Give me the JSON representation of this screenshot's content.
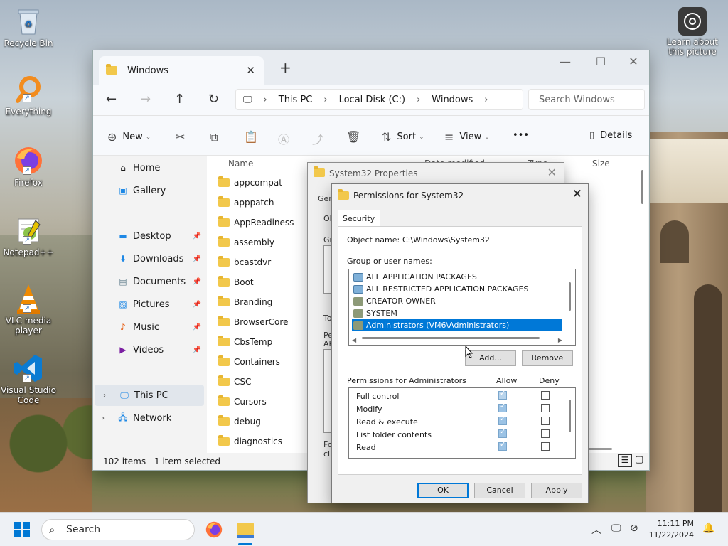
{
  "desktop": {
    "icons": [
      {
        "label": "Recycle Bin",
        "icon": "recycle-bin-icon"
      },
      {
        "label": "Everything",
        "icon": "everything-search-icon"
      },
      {
        "label": "Firefox",
        "icon": "firefox-icon"
      },
      {
        "label": "Notepad++",
        "icon": "notepad-plus-plus-icon"
      },
      {
        "label": "VLC media player",
        "icon": "vlc-icon"
      },
      {
        "label": "Visual Studio Code",
        "icon": "vscode-icon"
      }
    ],
    "learn": {
      "label": "Learn about this picture",
      "icon": "camera-icon"
    }
  },
  "explorer": {
    "tab_title": "Windows",
    "breadcrumbs": [
      "This PC",
      "Local Disk (C:)",
      "Windows"
    ],
    "search_placeholder": "Search Windows",
    "commands": {
      "new": "New",
      "sort": "Sort",
      "view": "View",
      "more": "•••",
      "details": "Details"
    },
    "sidebar": {
      "home": "Home",
      "gallery": "Gallery",
      "desktop": "Desktop",
      "downloads": "Downloads",
      "documents": "Documents",
      "pictures": "Pictures",
      "music": "Music",
      "videos": "Videos",
      "this_pc": "This PC",
      "network": "Network"
    },
    "columns": {
      "name": "Name",
      "date": "Date modified",
      "type": "Type",
      "size": "Size"
    },
    "files": [
      "appcompat",
      "apppatch",
      "AppReadiness",
      "assembly",
      "bcastdvr",
      "Boot",
      "Branding",
      "BrowserCore",
      "CbsTemp",
      "Containers",
      "CSC",
      "Cursors",
      "debug",
      "diagnostics"
    ],
    "status": {
      "items": "102 items",
      "selected": "1 item selected"
    }
  },
  "properties_dialog": {
    "title": "System32 Properties",
    "fragments": {
      "gen": "Gen",
      "obj": "Ob",
      "grp": "Gro",
      "to": "To",
      "per": "Per",
      "ap": "AP",
      "for": "For",
      "cli": "clic"
    }
  },
  "permissions_dialog": {
    "title": "Permissions for System32",
    "tab": "Security",
    "object_name_label": "Object name:",
    "object_name_value": "C:\\Windows\\System32",
    "group_label": "Group or user names:",
    "groups": [
      "ALL APPLICATION PACKAGES",
      "ALL RESTRICTED APPLICATION PACKAGES",
      "CREATOR OWNER",
      "SYSTEM",
      "Administrators (VM6\\Administrators)"
    ],
    "add_button": "Add...",
    "remove_button": "Remove",
    "permissions_label": "Permissions for Administrators",
    "allow_label": "Allow",
    "deny_label": "Deny",
    "permissions": [
      "Full control",
      "Modify",
      "Read & execute",
      "List folder contents",
      "Read"
    ],
    "ok_button": "OK",
    "cancel_button": "Cancel",
    "apply_button": "Apply"
  },
  "taskbar": {
    "search": "Search",
    "time": "11:11 PM",
    "date": "11/22/2024"
  }
}
